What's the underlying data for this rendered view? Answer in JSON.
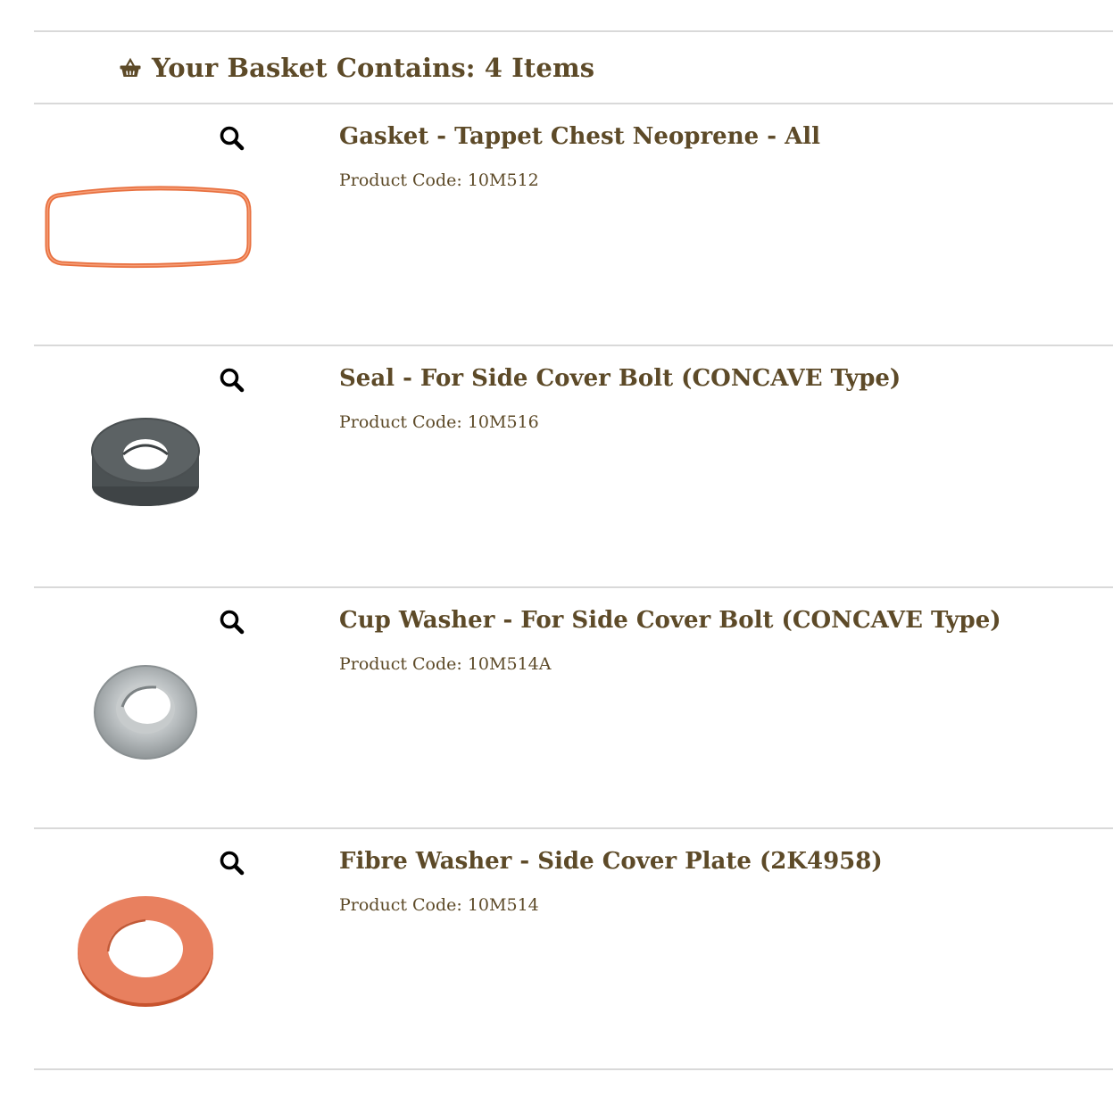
{
  "basket": {
    "heading": "Your Basket Contains: 4 Items",
    "icon": "basket-icon"
  },
  "colors": {
    "text": "#5d4a28",
    "divider": "#d9d9d9"
  },
  "items": [
    {
      "title": "Gasket - Tappet Chest Neoprene - All",
      "product_code": "Product Code: 10M512",
      "image": "orange-rectangular-gasket"
    },
    {
      "title": "Seal - For Side Cover Bolt (CONCAVE Type)",
      "product_code": "Product Code: 10M516",
      "image": "grey-rubber-seal"
    },
    {
      "title": "Cup Washer - For Side Cover Bolt (CONCAVE Type)",
      "product_code": "Product Code: 10M514A",
      "image": "silver-cup-washer"
    },
    {
      "title": "Fibre Washer - Side Cover Plate (2K4958)",
      "product_code": "Product Code: 10M514",
      "image": "orange-fibre-washer"
    }
  ]
}
